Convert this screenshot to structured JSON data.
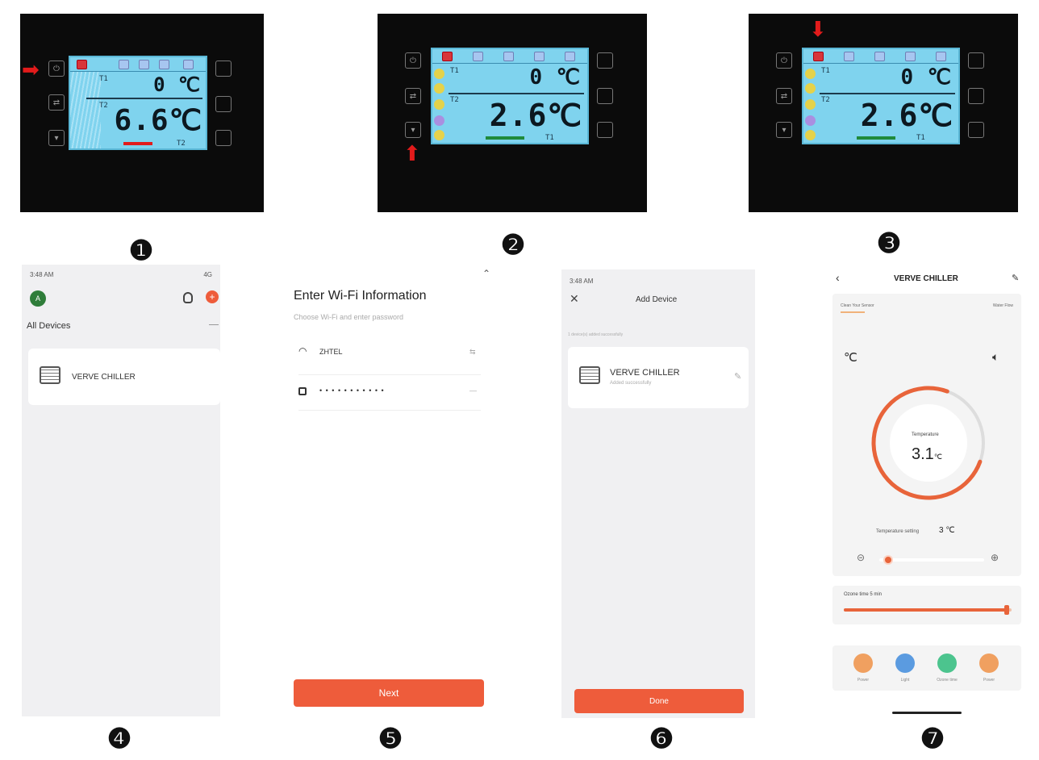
{
  "steps": {
    "s1": "❶",
    "s2": "❷",
    "s3": "❸",
    "s4": "❹",
    "s5": "❺",
    "s6": "❻",
    "s7": "❼"
  },
  "controller": {
    "panel1": {
      "upper": "0 ℃",
      "lower": "6.6℃",
      "t1": "T1",
      "t2": "T2",
      "code": "T2",
      "indicator_color": "#e21b1b"
    },
    "panel2": {
      "upper": "0 ℃",
      "lower": "2.6℃",
      "t1": "T1",
      "t2": "T2",
      "code": "T1",
      "indicator_color": "#1f8a3b"
    },
    "panel3": {
      "upper": "0 ℃",
      "lower": "2.6℃",
      "t1": "T1",
      "t2": "T2",
      "code": "T1",
      "indicator_color": "#1f8a3b"
    },
    "arrow_icon": "red-arrow-icon"
  },
  "screen4": {
    "status_time": "3:48 AM",
    "status_right": "4G",
    "avatar": "A",
    "section": "All Devices",
    "device": "VERVE CHILLER"
  },
  "screen5": {
    "title": "Enter Wi-Fi Information",
    "subtitle": "Choose Wi-Fi and enter password",
    "ssid": "ZHTEL",
    "password": "• • • • • • • • • • •",
    "next": "Next"
  },
  "screen6": {
    "status_time": "3:48 AM",
    "title": "Add Device",
    "note": "1 device(s) added successfully",
    "device": "VERVE CHILLER",
    "device_sub": "Added successfully",
    "done": "Done"
  },
  "screen7": {
    "title": "VERVE CHILLER",
    "left_info": "Clean Your Sensor",
    "right_info": "Water Flow",
    "unit_icon": "℃",
    "temp_label": "Temperature",
    "temp_value": "3.1",
    "temp_unit": "℃",
    "setting_label": "Temperature setting",
    "setting_value": "3 ℃",
    "ozone_label": "Ozone time 5 min",
    "dial_level": 0.75,
    "setting_slider_level": 0.05,
    "ozone_slider_level": 0.97,
    "buttons": [
      {
        "label": "Power",
        "color": "#f0a060"
      },
      {
        "label": "Light",
        "color": "#5b9be0"
      },
      {
        "label": "Ozone time",
        "color": "#4cc48e"
      },
      {
        "label": "Power",
        "color": "#f0a060"
      }
    ],
    "accent": "#e8643a"
  }
}
